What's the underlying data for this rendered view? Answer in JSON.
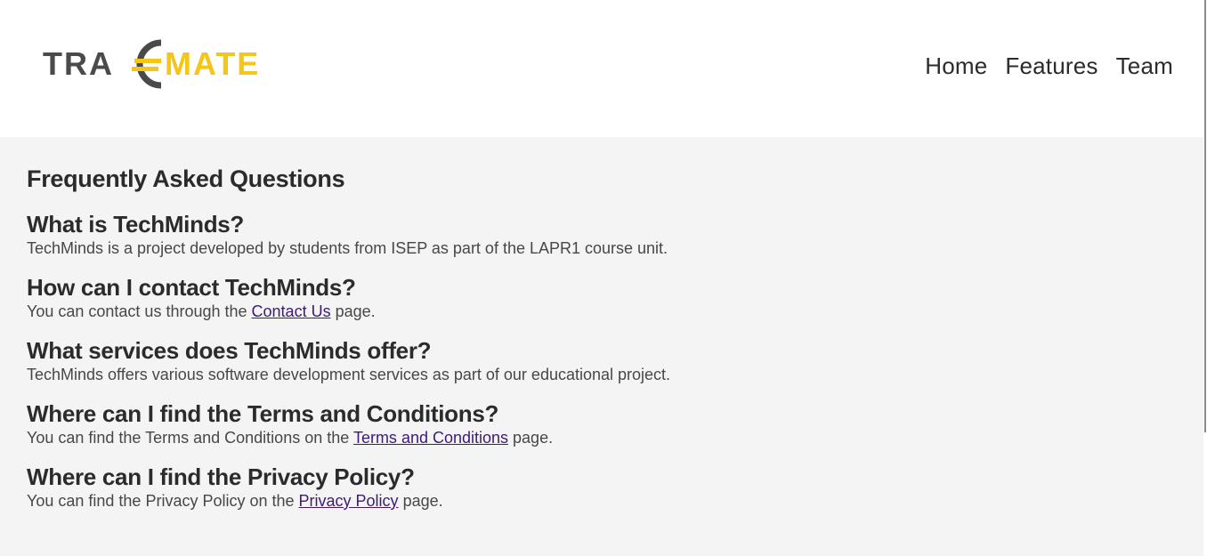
{
  "header": {
    "logo_text_left": "TRA",
    "logo_text_right": "MATE",
    "nav": [
      {
        "label": "Home"
      },
      {
        "label": "Features"
      },
      {
        "label": "Team"
      }
    ]
  },
  "colors": {
    "logo_gray": "#4a4a4a",
    "logo_yellow": "#f5c518",
    "link": "#3e1a78",
    "content_bg": "#f4f4f4"
  },
  "main": {
    "title": "Frequently Asked Questions",
    "faqs": [
      {
        "question": "What is TechMinds?",
        "answer_before": "TechMinds is a project developed by students from ISEP as part of the LAPR1 course unit.",
        "link": "",
        "answer_after": ""
      },
      {
        "question": "How can I contact TechMinds?",
        "answer_before": "You can contact us through the ",
        "link": "Contact Us",
        "answer_after": " page."
      },
      {
        "question": "What services does TechMinds offer?",
        "answer_before": "TechMinds offers various software development services as part of our educational project.",
        "link": "",
        "answer_after": ""
      },
      {
        "question": "Where can I find the Terms and Conditions?",
        "answer_before": "You can find the Terms and Conditions on the ",
        "link": "Terms and Conditions",
        "answer_after": " page."
      },
      {
        "question": "Where can I find the Privacy Policy?",
        "answer_before": "You can find the Privacy Policy on the ",
        "link": "Privacy Policy",
        "answer_after": " page."
      }
    ]
  }
}
